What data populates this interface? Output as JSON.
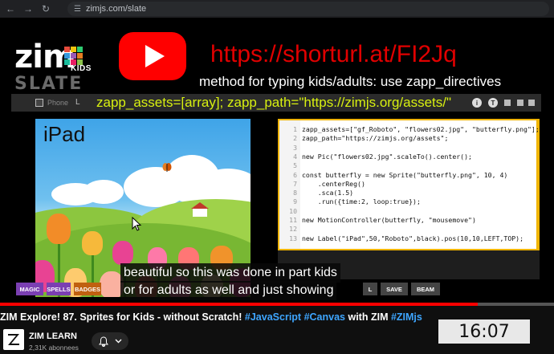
{
  "browser": {
    "url": "zimjs.com/slate"
  },
  "overlay": {
    "logo_text": "zim",
    "logo_kids": "KIDS",
    "logo_slate": "SLATE",
    "short_url": "https://shorturl.at/FI2Jq",
    "method_text": "method for typing kids/adults: use zapp_directives",
    "zapp_line": "zapp_assets=[array]; zapp_path=\"https://zimjs.org/assets/\""
  },
  "editor": {
    "phone_label": "Phone",
    "l_label": "L",
    "t_icon": "T",
    "ipad_label": "iPad",
    "code_lines": [
      {
        "n": "1",
        "text": "zapp_assets=[\"gf_Roboto\", \"flowers02.jpg\", \"butterfly.png\"];"
      },
      {
        "n": "2",
        "text": "zapp_path=\"https://zimjs.org/assets\";"
      },
      {
        "n": "3",
        "text": ""
      },
      {
        "n": "4",
        "text": "new Pic(\"flowers02.jpg\".scaleTo().center();"
      },
      {
        "n": "5",
        "text": ""
      },
      {
        "n": "6",
        "text": "const butterfly = new Sprite(\"butterfly.png\", 10, 4)"
      },
      {
        "n": "7",
        "text": "    .centerReg()"
      },
      {
        "n": "8",
        "text": "    .sca(1.5)"
      },
      {
        "n": "9",
        "text": "    .run({time:2, loop:true});"
      },
      {
        "n": "10",
        "text": ""
      },
      {
        "n": "11",
        "text": "new MotionController(butterfly, \"mousemove\")"
      },
      {
        "n": "12",
        "text": ""
      },
      {
        "n": "13",
        "text": "new Label(\"iPad\",50,\"Roboto\",black).pos(10,10,LEFT,TOP);"
      }
    ],
    "buttons": {
      "magic": "MAGIC",
      "spells": "SPELLS",
      "badges": "BADGES",
      "l": "L",
      "save": "SAVE",
      "beam": "BEAM"
    }
  },
  "subtitles": {
    "line1": "beautiful so this was done in part kids",
    "line2": "or for adults as well and just showing"
  },
  "player": {
    "progress_fraction": 0.862,
    "accent": "#ff0000"
  },
  "video": {
    "title_prefix": "ZIM Explore! 87. Sprites for Kids - without Scratch! ",
    "tag1": "#JavaScript",
    "tag2": "#Canvas",
    "mid": " with ZIM ",
    "tag3": "#ZIMjs",
    "channel_name": "ZIM LEARN",
    "subscribers": "2,31K abonnees",
    "timestamp": "16:07"
  }
}
